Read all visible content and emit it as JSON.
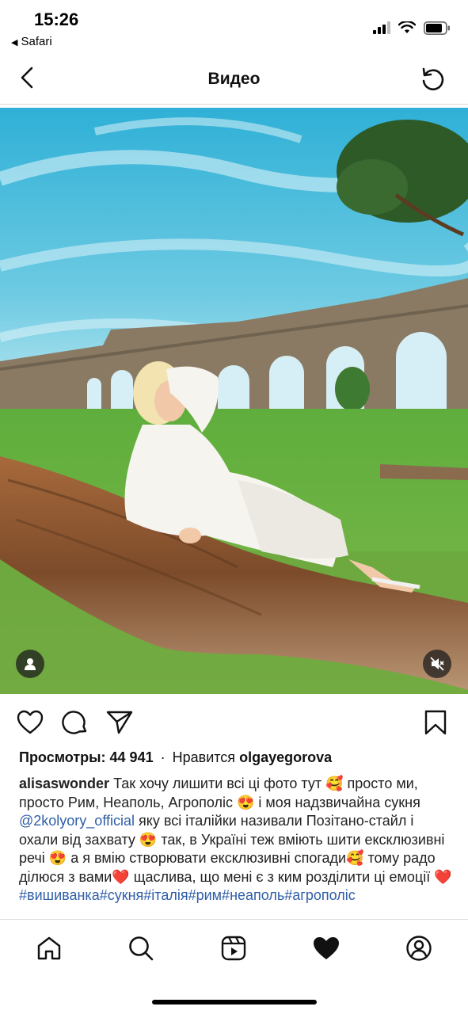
{
  "status_bar": {
    "time": "15:26",
    "back_app": "Safari",
    "icons": [
      "cellular-signal-icon",
      "wifi-icon",
      "battery-icon"
    ]
  },
  "nav": {
    "title": "Видео",
    "back_icon": "chevron-left-icon",
    "refresh_icon": "refresh-icon"
  },
  "video": {
    "subject": "woman in white dress reclining on a fallen tree trunk in front of an ancient aqueduct",
    "user_tag_icon": "person-icon",
    "mute_icon": "muted-speaker-icon"
  },
  "actions": {
    "like_icon": "heart-outline-icon",
    "comment_icon": "comment-icon",
    "share_icon": "send-icon",
    "save_icon": "bookmark-icon"
  },
  "stats": {
    "views_label": "Просмотры:",
    "views_count": "44 941",
    "separator": "·",
    "liked_by_label": "Нравится",
    "liked_by_user": "olgayegorova"
  },
  "caption": {
    "author": "alisaswonder",
    "text_1": "Так хочу лишити всі ці фото тут 🥰 просто ми, просто Рим, Неаполь, Агрополіс 😍 і моя надзвичайна сукня",
    "mention": "@2kolyory_official",
    "text_2": "яку всі італійки називали Позітано-стайл і охали від захвату 😍 так, в Україні теж вміють шити ексклюзивні речі 😍 а я вмію створювати ексклюзивні спогади🥰 тому радо ділюся з вами❤️ щаслива, що мені є з ким розділити ці емоції ❤️",
    "hashtags": "#вишиванка#сукня#італія#рим#неаполь#агрополіс"
  },
  "tabbar": {
    "items": [
      "home-icon",
      "search-icon",
      "reels-icon",
      "activity-heart-icon",
      "profile-icon"
    ]
  },
  "colors": {
    "link": "#2f5ea8",
    "divider": "#dbdbdb",
    "sky": "#3fb8d8",
    "grass": "#5fa83a"
  }
}
